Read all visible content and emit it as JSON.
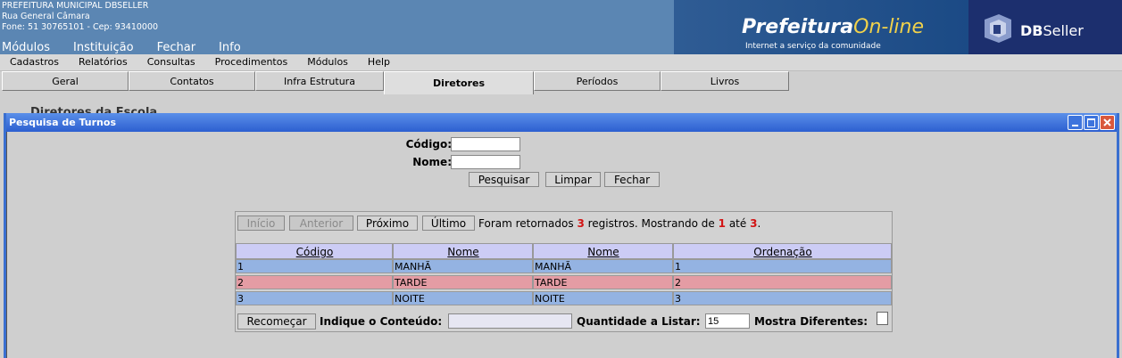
{
  "banner": {
    "org_name": "PREFEITURA MUNICIPAL DBSELLER",
    "address": "Rua General Câmara",
    "phone": "Fone: 51 30765101  -  Cep: 93410000",
    "logo_prefix": "Prefeitura",
    "logo_suffix": "On-line",
    "logo_tagline": "Internet a serviço da comunidade",
    "brand_db": "DB",
    "brand_seller": "Seller"
  },
  "top_menu": [
    "Módulos",
    "Instituição",
    "Fechar",
    "Info"
  ],
  "menubar": [
    "Cadastros",
    "Relatórios",
    "Consultas",
    "Procedimentos",
    "Módulos",
    "Help"
  ],
  "tabs": [
    "Geral",
    "Contatos",
    "Infra Estrutura",
    "Diretores",
    "Períodos",
    "Livros"
  ],
  "active_tab": "Diretores",
  "background_heading": "Diretores da Escola",
  "window": {
    "title": "Pesquisa de Turnos",
    "codigo_label": "Código:",
    "nome_label": "Nome:",
    "codigo_value": "",
    "nome_value": "",
    "pesquisar": "Pesquisar",
    "limpar": "Limpar",
    "fechar": "Fechar"
  },
  "pager": {
    "inicio": "Início",
    "anterior": "Anterior",
    "proximo": "Próximo",
    "ultimo": "Último",
    "txt1": "Foram retornados",
    "total": "3",
    "txt2": "registros. Mostrando de",
    "from": "1",
    "txt3": "até",
    "to": "3",
    "txt4": "."
  },
  "table": {
    "headers": [
      "Código",
      "Nome",
      "Nome",
      "Ordenação"
    ],
    "rows": [
      [
        "1",
        "MANHÃ",
        "MANHÃ",
        "1"
      ],
      [
        "2",
        "TARDE",
        "TARDE",
        "2"
      ],
      [
        "3",
        "NOITE",
        "NOITE",
        "3"
      ]
    ]
  },
  "footer": {
    "recomecar": "Recomeçar",
    "indique": "Indique o Conteúdo:",
    "indique_value": "",
    "quantidade": "Quantidade a Listar:",
    "quantidade_value": "15",
    "mostra": "Mostra Diferentes:"
  },
  "colors": {
    "banner": "#5b86b3",
    "titlebar": "#2d5fd0",
    "row_odd": "#94b3e2",
    "row_even": "#e49ca4",
    "header": "#ccccf5",
    "highlight": "#d21414"
  }
}
